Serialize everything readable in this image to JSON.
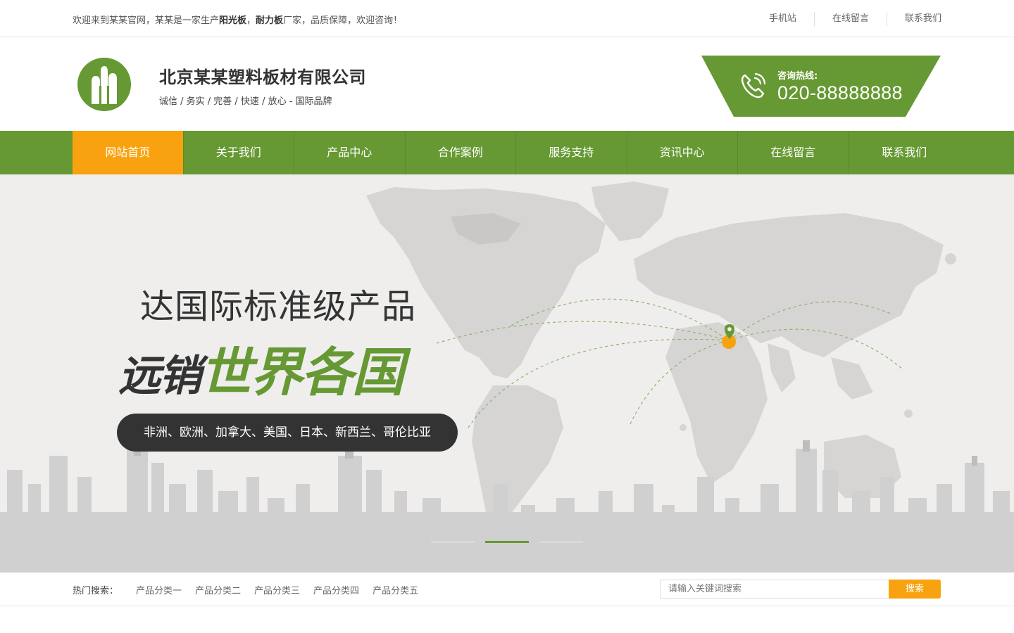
{
  "topbar": {
    "welcome_prefix": "欢迎来到某某官网，某某是一家生产",
    "welcome_bold1": "阳光板",
    "welcome_sep": "，",
    "welcome_bold2": "耐力板",
    "welcome_suffix": "厂家，品质保障，欢迎咨询！",
    "links": [
      "手机站",
      "在线留言",
      "联系我们"
    ]
  },
  "header": {
    "company_name": "北京某某塑料板材有限公司",
    "slogan": "诚信 / 务实 / 完善 / 快速 / 放心 - 国际品牌",
    "hotline_label": "咨询热线:",
    "hotline_number": "020-88888888"
  },
  "nav": {
    "items": [
      "网站首页",
      "关于我们",
      "产品中心",
      "合作案例",
      "服务支持",
      "资讯中心",
      "在线留言",
      "联系我们"
    ],
    "active_index": 0
  },
  "banner": {
    "headline": "达国际标准级产品",
    "slogan_dark": "远销",
    "slogan_green": "世界各国",
    "countries": "非洲、欧洲、加拿大、美国、日本、新西兰、哥伦比亚",
    "slide_count": 3,
    "active_slide": 1
  },
  "search": {
    "hot_label": "热门搜索：",
    "hot_links": [
      "产品分类一",
      "产品分类二",
      "产品分类三",
      "产品分类四",
      "产品分类五"
    ],
    "placeholder": "请输入关键词搜索",
    "button_label": "搜索"
  },
  "colors": {
    "brand_green": "#669933",
    "accent_orange": "#f9a20f",
    "dark": "#333333"
  }
}
